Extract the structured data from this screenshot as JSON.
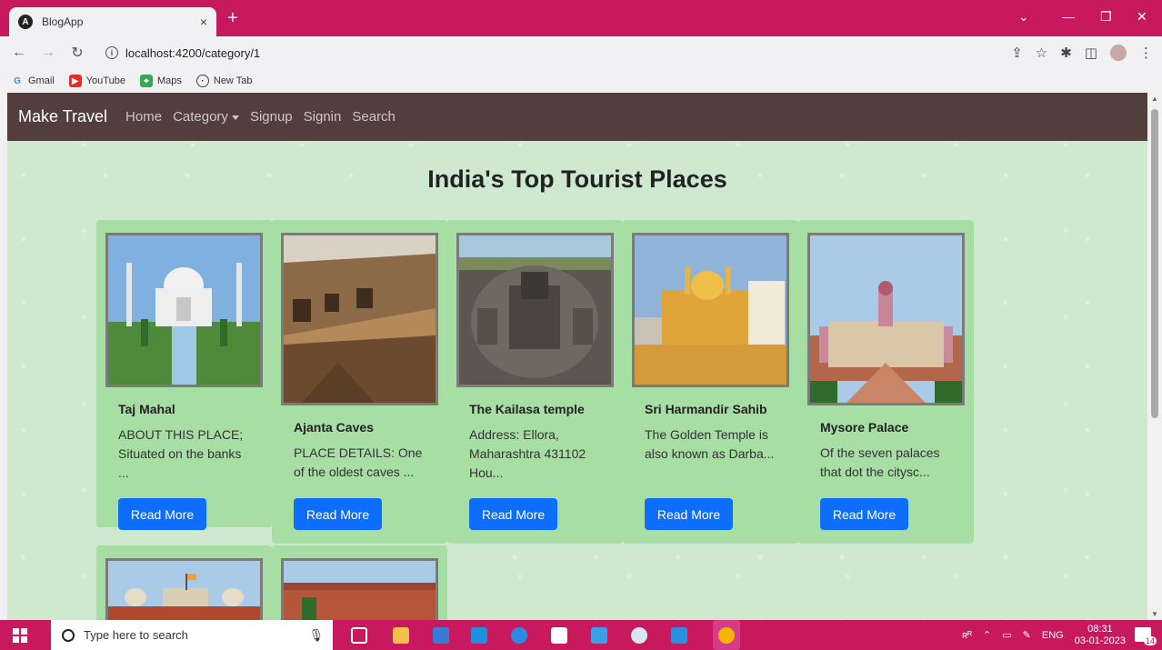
{
  "browser": {
    "tab_title": "BlogApp",
    "tab_close": "×",
    "new_tab": "+",
    "url": "localhost:4200/category/1",
    "bookmarks": [
      "Gmail",
      "YouTube",
      "Maps",
      "New Tab"
    ]
  },
  "navbar": {
    "brand": "Make Travel",
    "links": [
      "Home",
      "Category",
      "Signup",
      "Signin",
      "Search"
    ]
  },
  "page": {
    "title": "India's Top Tourist Places",
    "read_more_label": "Read More"
  },
  "cards": [
    {
      "title": "Taj Mahal",
      "text": "ABOUT THIS PLACE; Situated on the banks ..."
    },
    {
      "title": "Ajanta Caves",
      "text": "PLACE DETAILS: One of the oldest caves ..."
    },
    {
      "title": "The Kailasa temple",
      "text": "Address: Ellora, Maharashtra 431102 Hou..."
    },
    {
      "title": "Sri Harmandir Sahib",
      "text": "The Golden Temple is also known as Darba..."
    },
    {
      "title": "Mysore Palace",
      "text": "Of the seven palaces that dot the citysc..."
    }
  ],
  "taskbar": {
    "search_placeholder": "Type here to search",
    "lang": "ENG",
    "time": "08:31",
    "date": "03-01-2023",
    "notifications": "14"
  },
  "colors": {
    "chrome": "#c8195f",
    "navbar": "#523f3d",
    "page_bg": "#cfe8d0",
    "card_bg": "#a6dea3",
    "button": "#0d6efd"
  }
}
